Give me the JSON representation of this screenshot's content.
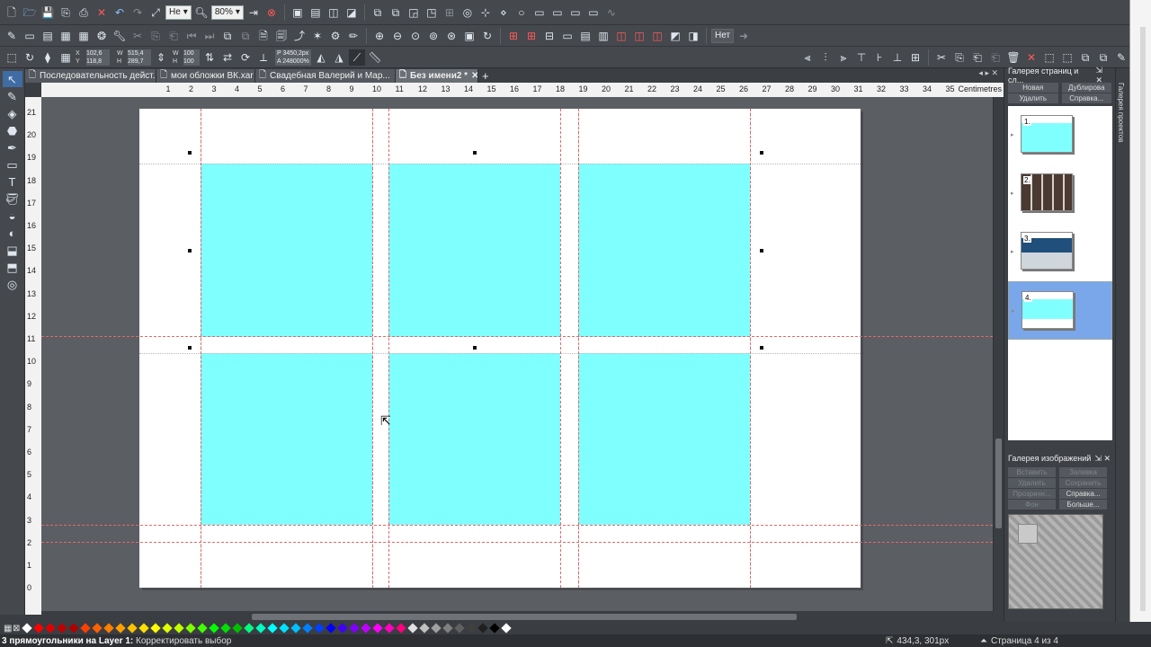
{
  "toolbar_top": {
    "zoom_mode": "Не",
    "zoom_value": "80%"
  },
  "toolbar_mid": {
    "dup_mode": "Нет"
  },
  "infobar": {
    "x_label": "X",
    "x_value": "102,6",
    "y_label": "Y",
    "y_value": "118,8",
    "w_label": "W",
    "w_value": "515,4",
    "h_label": "H",
    "h_value": "289,7",
    "sw_value": "100",
    "sh_value": "100",
    "rot": "P 3450,2px",
    "skew": "A 248000%"
  },
  "tabs": [
    {
      "label": "Последовательность дейст...",
      "active": false
    },
    {
      "label": "мои обложки ВК.xar",
      "active": false
    },
    {
      "label": "Свадебная Валерий и Мар...",
      "active": false
    },
    {
      "label": "Без имени2 *",
      "active": true
    }
  ],
  "ruler": {
    "units": "Centimetres",
    "h_ticks": [
      "1",
      "2",
      "3",
      "4",
      "5",
      "6",
      "7",
      "8",
      "9",
      "10",
      "11",
      "12",
      "13",
      "14",
      "15",
      "16",
      "17",
      "18",
      "19",
      "20",
      "21",
      "22",
      "23",
      "24",
      "25",
      "26",
      "27",
      "28",
      "29",
      "30",
      "31",
      "32",
      "33",
      "34",
      "35"
    ],
    "v_ticks": [
      "21",
      "20",
      "19",
      "18",
      "17",
      "16",
      "15",
      "14",
      "13",
      "12",
      "11",
      "10",
      "9",
      "8",
      "7",
      "6",
      "5",
      "4",
      "3",
      "2",
      "1",
      "0"
    ]
  },
  "page_gallery": {
    "title": "Галерея страниц и сл...",
    "buttons": [
      "Новая",
      "Дублирова",
      "Удалить",
      "Справка..."
    ],
    "pages": [
      {
        "num": "1.",
        "selected": false
      },
      {
        "num": "2.",
        "selected": false
      },
      {
        "num": "3.",
        "selected": false
      },
      {
        "num": "4.",
        "selected": true
      }
    ]
  },
  "image_gallery": {
    "title": "Галерея изображений",
    "buttons": [
      "Вставить",
      "Заливка",
      "Удалить",
      "Сохранить",
      "Прозрачн...",
      "Справка...",
      "Фон",
      "Больше..."
    ]
  },
  "side_tab": "Галерея проектов",
  "status": {
    "selection": "3 прямоугольники на Layer 1:",
    "hint": "Корректировать выбор",
    "coords": "434,3, 301px",
    "page": "Страница 4 из 4"
  },
  "palette": [
    "#ffffff",
    "#ff0000",
    "#e00000",
    "#c00000",
    "#b00000",
    "#ff4000",
    "#ff6000",
    "#ff8000",
    "#ffa000",
    "#ffc000",
    "#ffe000",
    "#ffff00",
    "#e0ff00",
    "#c0ff00",
    "#80ff00",
    "#40ff00",
    "#00ff00",
    "#00e000",
    "#00c000",
    "#00ff80",
    "#00ffc0",
    "#00ffff",
    "#00e0ff",
    "#00c0ff",
    "#0080ff",
    "#0040ff",
    "#0000ff",
    "#4000ff",
    "#8000ff",
    "#c000ff",
    "#ff00ff",
    "#ff00c0",
    "#ff0080",
    "#e0e0e0",
    "#c0c0c0",
    "#a0a0a0",
    "#808080",
    "#606060",
    "#404040",
    "#202020",
    "#000000",
    "#ffffff"
  ]
}
